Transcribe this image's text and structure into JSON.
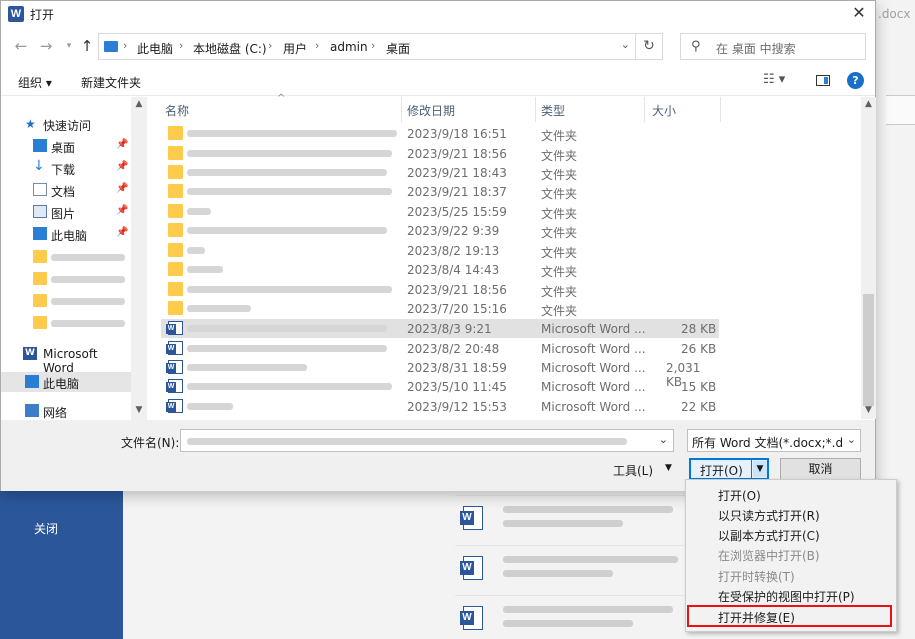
{
  "background": {
    "docx_text": ".docx",
    "left_item": "关闭",
    "accent": "#2b579a"
  },
  "dialog": {
    "title": "打开",
    "close_icon": "close-icon"
  },
  "address": {
    "crumbs": [
      "此电脑",
      "本地磁盘 (C:)",
      "用户",
      "admin",
      "桌面"
    ]
  },
  "search": {
    "placeholder": "在 桌面 中搜索"
  },
  "toolbar": {
    "organize": "组织 ▾",
    "new_folder": "新建文件夹"
  },
  "sidebar": {
    "quick_access": "快速访问",
    "desktop": "桌面",
    "downloads": "下载",
    "documents": "文档",
    "pictures": "图片",
    "this_pc_pinned": "此电脑",
    "microsoft_word": "Microsoft Word",
    "this_pc": "此电脑",
    "network": "网络"
  },
  "columns": {
    "name": "名称",
    "modified": "修改日期",
    "type": "类型",
    "size": "大小"
  },
  "files": [
    {
      "kind": "folder",
      "date": "2023/9/18 16:51",
      "type": "文件夹",
      "size": ""
    },
    {
      "kind": "folder",
      "date": "2023/9/21 18:56",
      "type": "文件夹",
      "size": ""
    },
    {
      "kind": "folder",
      "date": "2023/9/21 18:43",
      "type": "文件夹",
      "size": ""
    },
    {
      "kind": "folder",
      "date": "2023/9/21 18:37",
      "type": "文件夹",
      "size": ""
    },
    {
      "kind": "folder",
      "date": "2023/5/25 15:59",
      "type": "文件夹",
      "size": ""
    },
    {
      "kind": "folder",
      "date": "2023/9/22 9:39",
      "type": "文件夹",
      "size": ""
    },
    {
      "kind": "folder",
      "date": "2023/8/2 19:13",
      "type": "文件夹",
      "size": ""
    },
    {
      "kind": "folder",
      "date": "2023/8/4 14:43",
      "type": "文件夹",
      "size": ""
    },
    {
      "kind": "folder",
      "date": "2023/9/21 18:56",
      "type": "文件夹",
      "size": ""
    },
    {
      "kind": "folder",
      "date": "2023/7/20 15:16",
      "type": "文件夹",
      "size": ""
    },
    {
      "kind": "word",
      "date": "2023/8/3 9:21",
      "type": "Microsoft Word ...",
      "size": "28 KB"
    },
    {
      "kind": "word",
      "date": "2023/8/2 20:48",
      "type": "Microsoft Word ...",
      "size": "26 KB"
    },
    {
      "kind": "word",
      "date": "2023/8/31 18:59",
      "type": "Microsoft Word ...",
      "size": "2,031 KB"
    },
    {
      "kind": "word",
      "date": "2023/5/10 11:45",
      "type": "Microsoft Word ...",
      "size": "15 KB"
    },
    {
      "kind": "word",
      "date": "2023/9/12 15:53",
      "type": "Microsoft Word ...",
      "size": "22 KB"
    }
  ],
  "bottom": {
    "filename_label": "文件名(N):",
    "filetype": "所有 Word 文档(*.docx;*.docm",
    "tools": "工具(L)",
    "open": "打开(O)",
    "cancel": "取消"
  },
  "menu": {
    "items": [
      {
        "label": "打开(O)",
        "enabled": true
      },
      {
        "label": "以只读方式打开(R)",
        "enabled": true
      },
      {
        "label": "以副本方式打开(C)",
        "enabled": true
      },
      {
        "label": "在浏览器中打开(B)",
        "enabled": false
      },
      {
        "label": "打开时转换(T)",
        "enabled": false
      },
      {
        "label": "在受保护的视图中打开(P)",
        "enabled": true
      },
      {
        "label": "打开并修复(E)",
        "enabled": true
      }
    ],
    "highlight_color": "#e11111"
  }
}
